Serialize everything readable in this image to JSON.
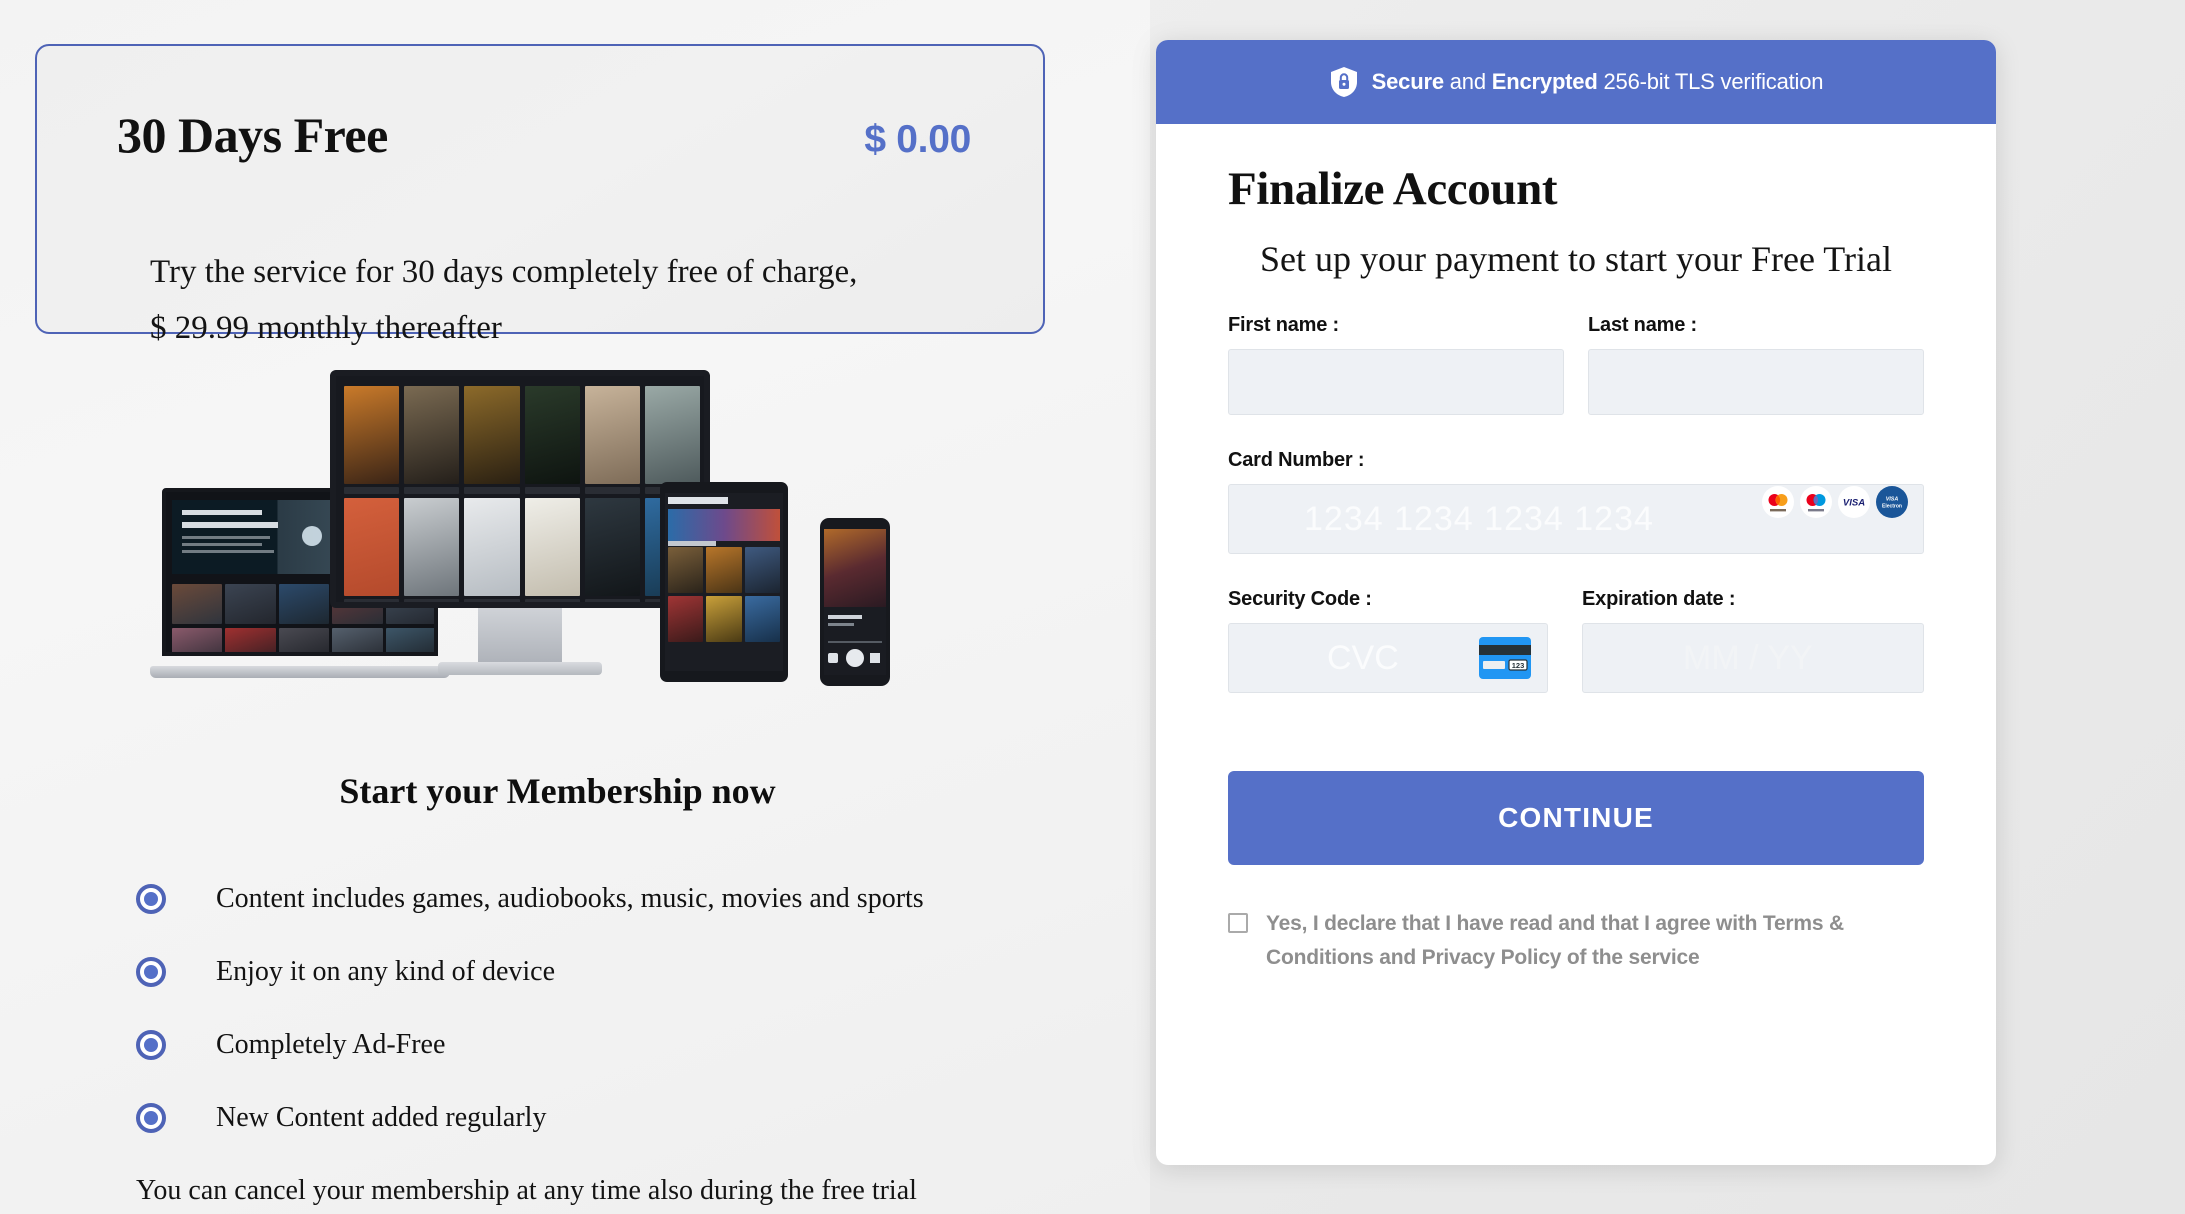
{
  "promo": {
    "title": "30 Days Free",
    "price": "$ 0.00",
    "description_line1": "Try the service for 30 days completely free of charge,",
    "description_line2": "$ 29.99 monthly thereafter"
  },
  "membership": {
    "heading": "Start your Membership now",
    "benefits": [
      "Content includes games, audiobooks, music, movies and sports",
      "Enjoy it on any kind of device",
      "Completely Ad-Free",
      "New Content added regularly"
    ],
    "cancel_note": "You can cancel your membership at any time also during the free trial"
  },
  "checkout": {
    "secure_banner": {
      "icon": "shield-lock-icon",
      "bold_1": "Secure",
      "mid": " and ",
      "bold_2": "Encrypted",
      "rest": " 256-bit TLS verification"
    },
    "title": "Finalize Account",
    "subtitle": "Set up your payment to start your Free Trial",
    "fields": {
      "first_name_label": "First name :",
      "first_name_value": "",
      "first_name_placeholder": "",
      "last_name_label": "Last name :",
      "last_name_value": "",
      "last_name_placeholder": "",
      "card_number_label": "Card Number :",
      "card_number_value": "",
      "card_number_placeholder": "1234 1234 1234 1234",
      "security_code_label": "Security Code :",
      "security_code_value": "",
      "security_code_placeholder": "CVC",
      "expiration_label": "Expiration date :",
      "expiration_value": "",
      "expiration_placeholder": "MM / YY"
    },
    "card_brands": [
      "mastercard-icon",
      "maestro-icon",
      "visa-icon",
      "visa-electron-icon"
    ],
    "cvc_hint_icon": "credit-card-cvc-icon",
    "continue_label": "CONTINUE",
    "terms_text": "Yes, I declare that I have read and that I agree with Terms & Conditions and Privacy Policy of the service",
    "terms_checked": false
  },
  "colors": {
    "accent": "#5570c8",
    "accent_border": "#4e63b6",
    "input_bg": "#eef1f5",
    "muted_text": "#8e8e8e"
  }
}
